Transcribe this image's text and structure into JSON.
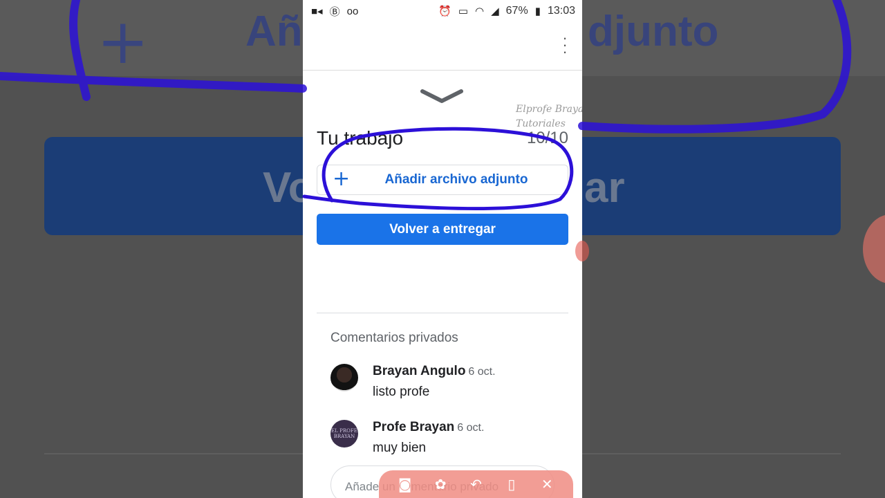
{
  "background": {
    "left_text": "Añ",
    "right_text": "djunto",
    "bar_left": "Vo",
    "bar_right": "ar"
  },
  "statusbar": {
    "battery": "67%",
    "time": "13:03",
    "icons": [
      "video-icon",
      "b-icon",
      "voicemail-icon",
      "alarm-icon",
      "cast-icon",
      "wifi-icon",
      "signal-icon",
      "battery-icon"
    ]
  },
  "watermark": {
    "line1": "Elprofe Brayan",
    "line2": "Tutoriales"
  },
  "work": {
    "title": "Tu trabajo",
    "count": "10/10",
    "attach_label": "Añadir archivo adjunto",
    "submit_label": "Volver a entregar"
  },
  "private_comments": {
    "title": "Comentarios privados",
    "items": [
      {
        "author": "Brayan Angulo",
        "date": "6 oct.",
        "text": "listo profe"
      },
      {
        "author": "Profe Brayan",
        "date": "6 oct.",
        "text": "muy bien",
        "avatar_text": "EL PROFE BRAYAN"
      }
    ],
    "input_placeholder": "Añade un comentario privado"
  },
  "recorder_toolbar": {
    "icons": [
      "camera-icon",
      "palette-icon",
      "undo-icon",
      "trash-icon",
      "close-icon"
    ]
  },
  "colors": {
    "accent": "#1a73e8",
    "annotation": "#2c10d8"
  }
}
